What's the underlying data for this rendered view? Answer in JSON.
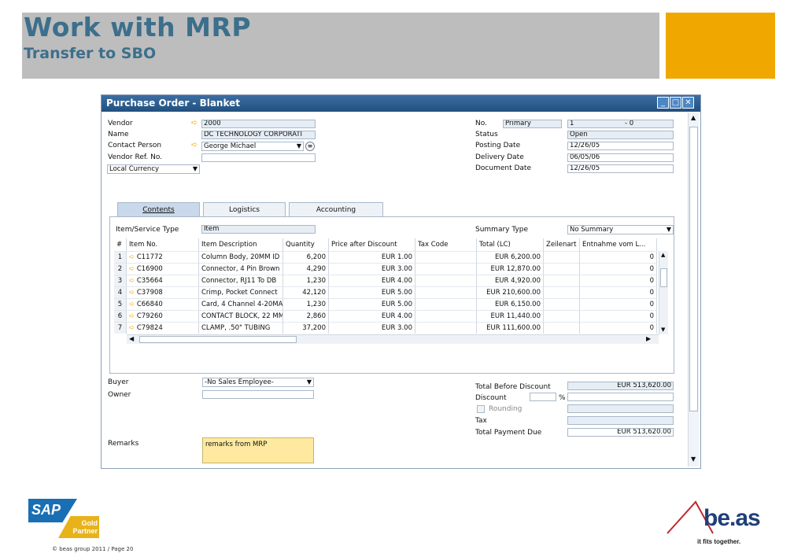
{
  "slide": {
    "title": "Work with MRP",
    "subtitle": "Transfer to SBO",
    "footer": "© beas group 2011 / Page 20"
  },
  "logos": {
    "sap_text": "SAP",
    "sap_badge": "Gold Partner",
    "beas_text": "be.as",
    "beas_tagline": "it fits together."
  },
  "window": {
    "title": "Purchase Order - Blanket",
    "controls": {
      "minimize": "_",
      "maximize": "□",
      "close": "✕"
    }
  },
  "header_left": {
    "vendor_label": "Vendor",
    "vendor_value": "2000",
    "name_label": "Name",
    "name_value": "DC TECHNOLOGY CORPORATI",
    "contact_label": "Contact Person",
    "contact_value": "George Michael",
    "ref_label": "Vendor Ref. No.",
    "ref_value": "",
    "currency_value": "Local Currency"
  },
  "header_right": {
    "no_label": "No.",
    "series": "Primary",
    "no_value": "1",
    "no_suffix": "- 0",
    "status_label": "Status",
    "status_value": "Open",
    "posting_label": "Posting Date",
    "posting_value": "12/26/05",
    "delivery_label": "Delivery Date",
    "delivery_value": "06/05/06",
    "document_label": "Document Date",
    "document_value": "12/26/05"
  },
  "tabs": [
    {
      "label": "Contents"
    },
    {
      "label": "Logistics"
    },
    {
      "label": "Accounting"
    }
  ],
  "contents": {
    "item_type_label": "Item/Service Type",
    "item_type_value": "Item",
    "summary_label": "Summary Type",
    "summary_value": "No Summary",
    "columns": [
      "#",
      "Item No.",
      "Item Description",
      "Quantity",
      "Price after Discount",
      "Tax Code",
      "Total (LC)",
      "Zeilenart",
      "Entnahme vom L..."
    ],
    "rows": [
      {
        "n": "1",
        "item": "C11772",
        "desc": "Column Body, 20MM ID",
        "qty": "6,200",
        "price": "EUR 1.00",
        "tax": "",
        "total": "EUR 6,200.00",
        "zeil": "",
        "ent": "0"
      },
      {
        "n": "2",
        "item": "C16900",
        "desc": "Connector, 4 Pin Brown",
        "qty": "4,290",
        "price": "EUR 3.00",
        "tax": "",
        "total": "EUR 12,870.00",
        "zeil": "",
        "ent": "0"
      },
      {
        "n": "3",
        "item": "C35664",
        "desc": "Connector, RJ11 To DB",
        "qty": "1,230",
        "price": "EUR 4.00",
        "tax": "",
        "total": "EUR 4,920.00",
        "zeil": "",
        "ent": "0"
      },
      {
        "n": "4",
        "item": "C37908",
        "desc": "Crimp, Pocket Connect",
        "qty": "42,120",
        "price": "EUR 5.00",
        "tax": "",
        "total": "EUR 210,600.00",
        "zeil": "",
        "ent": "0"
      },
      {
        "n": "5",
        "item": "C66840",
        "desc": "Card, 4 Channel 4-20MA",
        "qty": "1,230",
        "price": "EUR 5.00",
        "tax": "",
        "total": "EUR 6,150.00",
        "zeil": "",
        "ent": "0"
      },
      {
        "n": "6",
        "item": "C79260",
        "desc": "CONTACT BLOCK, 22 MM",
        "qty": "2,860",
        "price": "EUR 4.00",
        "tax": "",
        "total": "EUR 11,440.00",
        "zeil": "",
        "ent": "0"
      },
      {
        "n": "7",
        "item": "C79824",
        "desc": "CLAMP, .50\" TUBING",
        "qty": "37,200",
        "price": "EUR 3.00",
        "tax": "",
        "total": "EUR 111,600.00",
        "zeil": "",
        "ent": "0"
      }
    ]
  },
  "footer_left": {
    "buyer_label": "Buyer",
    "buyer_value": "-No Sales Employee-",
    "owner_label": "Owner",
    "owner_value": "",
    "remarks_label": "Remarks",
    "remarks_value": "remarks from MRP"
  },
  "totals": {
    "before_label": "Total Before Discount",
    "before_value": "EUR 513,620.00",
    "discount_label": "Discount",
    "discount_pct": "%",
    "rounding_label": "Rounding",
    "tax_label": "Tax",
    "due_label": "Total Payment Due",
    "due_value": "EUR 513,620.00"
  },
  "colors": {
    "title_blue": "#3c6f8c",
    "band_gray": "#bdbdbd",
    "accent_orange": "#f0a800",
    "window_blue": "#21507f"
  }
}
